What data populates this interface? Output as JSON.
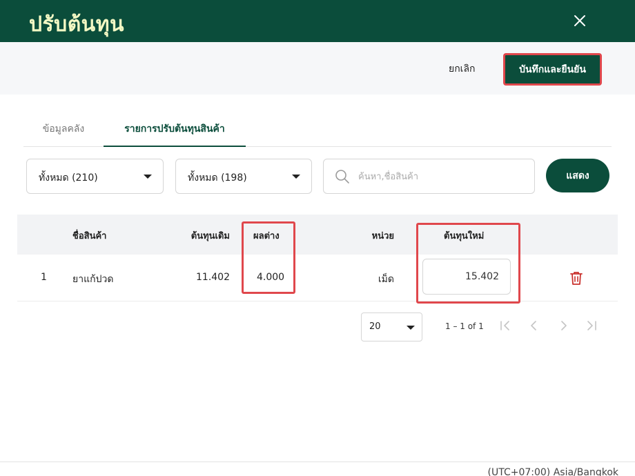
{
  "dialog": {
    "title": "ปรับต้นทุน"
  },
  "actions": {
    "cancel_label": "ยกเลิก",
    "save_label": "บันทึกและยืนยัน"
  },
  "tabs": [
    {
      "label": "ข้อมูลคลัง",
      "active": false
    },
    {
      "label": "รายการปรับต้นทุนสินค้า",
      "active": true
    }
  ],
  "filters": {
    "select1": "ทั้งหมด (210)",
    "select2": "ทั้งหมด (198)",
    "search_placeholder": "ค้นหา,ชื่อสินค้า",
    "show_label": "แสดง"
  },
  "table": {
    "headers": {
      "name": "ชื่อสินค้า",
      "old_cost": "ต้นทุนเดิม",
      "diff": "ผลต่าง",
      "unit": "หน่วย",
      "new_cost": "ต้นทุนใหม่"
    },
    "rows": [
      {
        "no": "1",
        "name": "ยาแก้ปวด",
        "old_cost": "11.402",
        "diff": "4.000",
        "unit": "เม็ด",
        "new_cost": "15.402"
      }
    ]
  },
  "pagination": {
    "page_size": "20",
    "range": "1 – 1 of 1"
  },
  "footer": {
    "timezone": "(UTC+07:00) Asia/Bangkok"
  },
  "colors": {
    "primary": "#0b4d3b",
    "title_text": "#f3f8c4",
    "highlight": "#e0474c",
    "danger": "#c9302c"
  }
}
